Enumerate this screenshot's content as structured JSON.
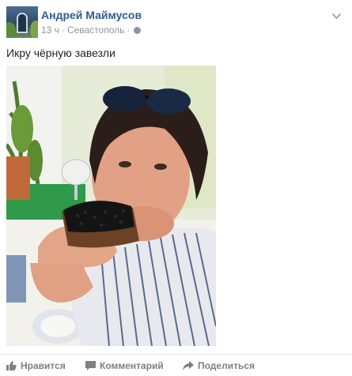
{
  "post": {
    "author": "Андрей Маймусов",
    "time": "13 ч",
    "location": "Севастополь",
    "privacy_icon": "globe-icon",
    "text": "Икру чёрную завезли"
  },
  "actions": [
    {
      "label": "Нравится",
      "icon": "thumbs-up-icon"
    },
    {
      "label": "Комментарий",
      "icon": "comment-icon"
    },
    {
      "label": "Поделиться",
      "icon": "share-icon"
    }
  ],
  "colors": {
    "author_link": "#365899",
    "meta_text": "#90949c",
    "action_text": "#7f7f7f",
    "divider": "#e5e5e5"
  }
}
